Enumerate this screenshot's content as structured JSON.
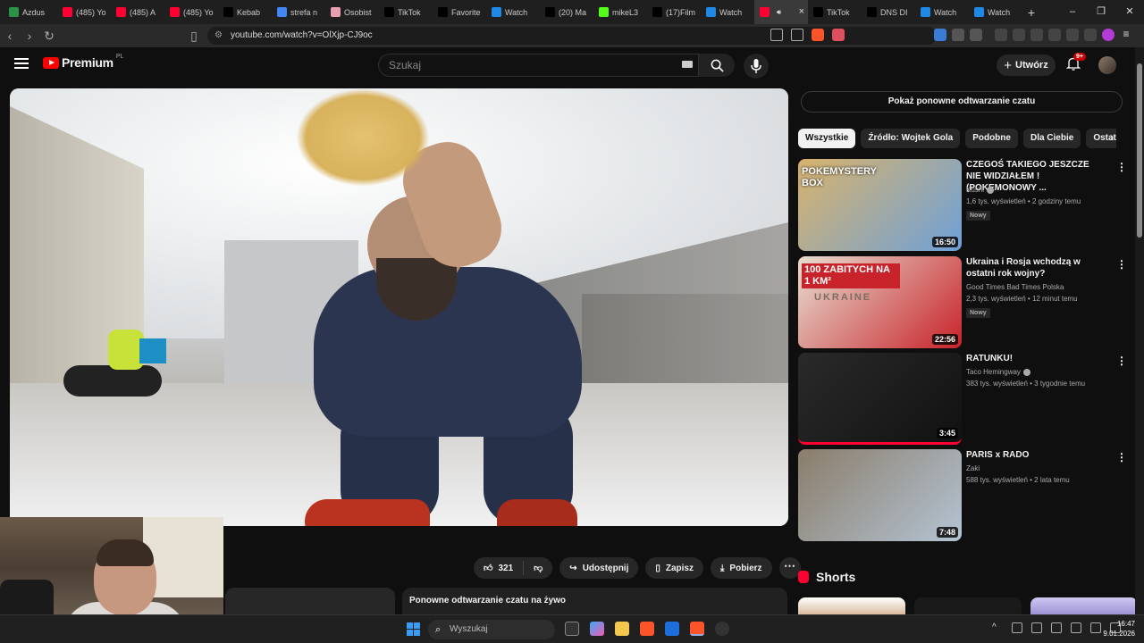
{
  "tabs": [
    {
      "label": "Azdus",
      "color": "#2b9348",
      "icon": "kick-icon"
    },
    {
      "label": "(485) Yo",
      "color": "#ff0033",
      "icon": "youtube-icon"
    },
    {
      "label": "(485) A",
      "color": "#ff0033",
      "icon": "youtube-icon"
    },
    {
      "label": "(485) Yo",
      "color": "#ff0033",
      "icon": "youtube-icon"
    },
    {
      "label": "Kebab",
      "color": "#000000",
      "icon": "tiktok-icon"
    },
    {
      "label": "strefa n",
      "color": "#4285f4",
      "icon": "google-icon"
    },
    {
      "label": "Osobist",
      "color": "#e8a0b0",
      "icon": "page-icon"
    },
    {
      "label": "TikTok",
      "color": "#000000",
      "icon": "tiktok-icon"
    },
    {
      "label": "Favorite",
      "color": "#000000",
      "icon": "tiktok-icon"
    },
    {
      "label": "Watch",
      "color": "#1e88e5",
      "icon": "watch-icon"
    },
    {
      "label": "(20) Ma",
      "color": "#000000",
      "icon": "x-icon"
    },
    {
      "label": "mikeL3",
      "color": "#53fc18",
      "icon": "kick-icon"
    },
    {
      "label": "(17)Film",
      "color": "#000000",
      "icon": "tiktok-icon"
    },
    {
      "label": "Watch",
      "color": "#1e88e5",
      "icon": "watch-icon"
    },
    {
      "label": "",
      "color": "#ff0033",
      "icon": "youtube-icon",
      "active": true
    },
    {
      "label": "TikTok",
      "color": "#000000",
      "icon": "tiktok-icon"
    },
    {
      "label": "DNS DI",
      "color": "#000000",
      "icon": "tiktok-icon"
    },
    {
      "label": "Watch",
      "color": "#1e88e5",
      "icon": "watch-icon"
    },
    {
      "label": "Watch",
      "color": "#1e88e5",
      "icon": "watch-icon"
    }
  ],
  "address": {
    "url": "youtube.com/watch?v=OlXjp-CJ9oc"
  },
  "header": {
    "logo_text": "Premium",
    "logo_region": "PL",
    "search_placeholder": "Szukaj",
    "create_label": "Utwórz",
    "notif_badge": "9+"
  },
  "actions": {
    "like_count": "321",
    "share_label": "Udostępnij",
    "save_label": "Zapisz",
    "download_label": "Pobierz"
  },
  "chat": {
    "show_replay_label": "Pokaż ponowne odtwarzanie czatu",
    "replay_title": "Ponowne odtwarzanie czatu na żywo"
  },
  "chips": [
    "Wszystkie",
    "Źródło: Wojtek Gola",
    "Podobne",
    "Dla Ciebie",
    "Ostatnio"
  ],
  "recommendations": [
    {
      "title": "CZEGOŚ TAKIEGO JESZCZE NIE WIDZIAŁEM ! (POKEMONOWY ...",
      "channel": "Kushi",
      "verified": true,
      "meta": "1,6 tys. wyświetleń • 2 godziny temu",
      "badge": "Nowy",
      "duration": "16:50",
      "thumb_label": "POKEMYSTERY BOX",
      "thumb_colors": [
        "#d9b36c",
        "#6ea0d8"
      ]
    },
    {
      "title": "Ukraina i Rosja wchodzą w ostatni rok wojny?",
      "channel": "Good Times Bad Times Polska",
      "verified": false,
      "meta": "2,3 tys. wyświetleń • 12 minut temu",
      "badge": "Nowy",
      "duration": "22:56",
      "thumb_label": "100 ZABITYCH NA 1 KM²",
      "thumb_sub": "UKRAINE",
      "thumb_colors": [
        "#e8dfd2",
        "#c8232a"
      ]
    },
    {
      "title": "RATUNKU!",
      "channel": "Taco Hemingway",
      "verified": true,
      "meta": "383 tys. wyświetleń • 3 tygodnie temu",
      "badge": "",
      "duration": "3:45",
      "thumb_colors": [
        "#2a2a2a",
        "#111111"
      ]
    },
    {
      "title": "PARIS x RADO",
      "channel": "Zaki",
      "verified": false,
      "meta": "588 tys. wyświetleń • 2 lata temu",
      "badge": "",
      "duration": "7:48",
      "thumb_colors": [
        "#8a7d6a",
        "#b4c4d4"
      ]
    }
  ],
  "shorts": {
    "label": "Shorts"
  },
  "taskbar": {
    "search_placeholder": "Wyszukaj",
    "time": "16:47",
    "date": "9.01.2026"
  }
}
